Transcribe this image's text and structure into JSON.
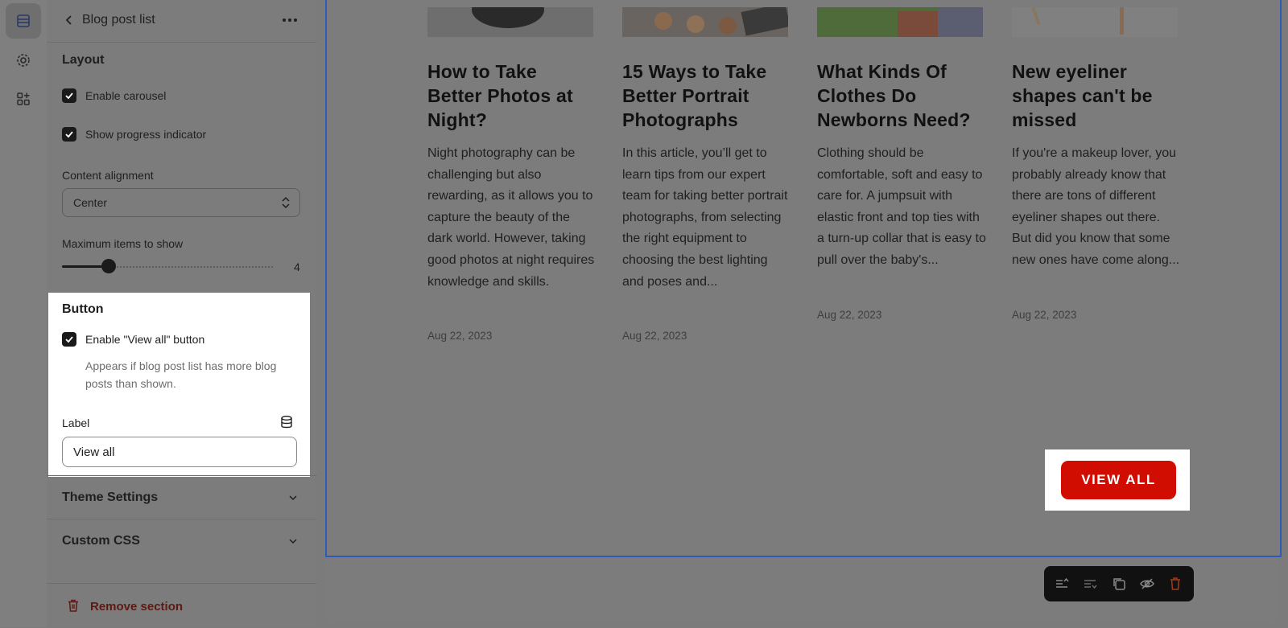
{
  "sidebar": {
    "header": {
      "title": "Blog post list"
    },
    "layout": {
      "title": "Layout",
      "enable_carousel": {
        "label": "Enable carousel",
        "checked": true
      },
      "show_progress": {
        "label": "Show progress indicator",
        "checked": true
      },
      "content_alignment": {
        "label": "Content alignment",
        "value": "Center"
      },
      "max_items": {
        "label": "Maximum items to show",
        "value": "4",
        "fraction": 0.22
      }
    },
    "button": {
      "title": "Button",
      "enable_view_all": {
        "label": "Enable \"View all\" button",
        "checked": true
      },
      "hint": "Appears if blog post list has more blog posts than shown.",
      "label_field": {
        "label": "Label",
        "value": "View all"
      }
    },
    "theme_settings": "Theme Settings",
    "custom_css": "Custom CSS",
    "remove_section": "Remove section"
  },
  "preview": {
    "posts": [
      {
        "title": "How to Take Better Photos at Night?",
        "excerpt": "Night photography can be challenging but also rewarding, as it allows you to capture the beauty of the dark world. However, taking good photos at night requires knowledge and skills.",
        "date": "Aug 22, 2023"
      },
      {
        "title": "15 Ways to Take Better Portrait Photographs",
        "excerpt": "In this article, you’ll get to learn tips from our expert team for taking better portrait photographs, from selecting the right equipment to choosing the best lighting and poses and...",
        "date": "Aug 22, 2023"
      },
      {
        "title": "What Kinds Of Clothes Do Newborns Need?",
        "excerpt": "Clothing should be comfortable, soft and easy to care for. A jumpsuit with elastic front and top ties with a turn-up collar that is easy to pull over the baby's...",
        "date": "Aug 22, 2023"
      },
      {
        "title": "New eyeliner shapes can't be missed",
        "excerpt": "If you're a makeup lover, you probably already know that there are tons of different eyeliner shapes out there. But did you know that some new ones have come along...",
        "date": "Aug 22, 2023"
      }
    ],
    "view_all_button": "VIEW ALL"
  },
  "colors": {
    "accent": "#d00d00",
    "selection": "#2e5bb8"
  },
  "icons": [
    "sections-icon",
    "settings-gear-icon",
    "apps-icon",
    "back-chevron-icon",
    "more-horizontal-icon",
    "database-icon",
    "trash-icon"
  ]
}
